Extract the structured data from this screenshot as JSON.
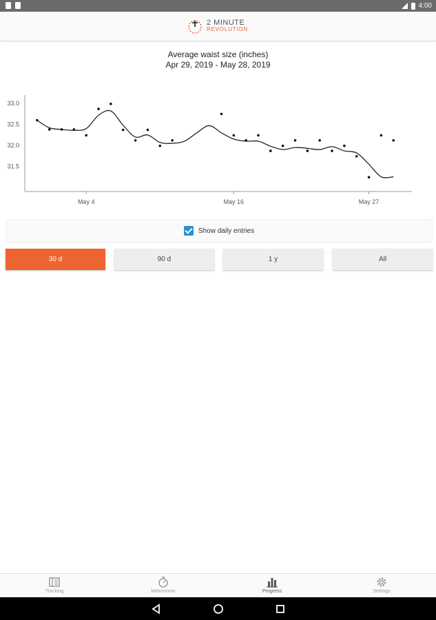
{
  "status_bar": {
    "time": "4:00"
  },
  "app_bar": {
    "logo_line1": "2 MINUTE",
    "logo_line2": "REVOLUTION"
  },
  "chart_title_line1": "Average waist size (inches)",
  "chart_title_line2": "Apr 29, 2019 - May 28, 2019",
  "chart_data": {
    "type": "line",
    "title": "Average waist size (inches)",
    "subtitle": "Apr 29, 2019 - May 28, 2019",
    "x_tick_labels": [
      "May 4",
      "May 16",
      "May 27"
    ],
    "x_tick_days": [
      5,
      17,
      28
    ],
    "y_tick_labels": [
      "33.0",
      "32.5",
      "32.0",
      "31.5"
    ],
    "y_ticks": [
      33.0,
      32.5,
      32.0,
      31.5
    ],
    "ylim": [
      30.9,
      33.2
    ],
    "xlim": [
      0,
      31.5
    ],
    "daily_entries": {
      "day": [
        1,
        2,
        3,
        4,
        5,
        6,
        7,
        8,
        9,
        10,
        11,
        12,
        16,
        17,
        18,
        19,
        20,
        21,
        22,
        23,
        24,
        25,
        26,
        27,
        28,
        29,
        30
      ],
      "waist": [
        32.6,
        32.38,
        32.38,
        32.38,
        32.24,
        32.87,
        32.99,
        32.37,
        32.12,
        32.37,
        31.99,
        32.12,
        32.75,
        32.24,
        32.12,
        32.24,
        31.87,
        31.99,
        32.12,
        31.87,
        32.12,
        31.87,
        31.99,
        31.74,
        31.24,
        32.24,
        32.12
      ]
    },
    "trend": {
      "day": [
        1,
        2,
        3,
        4,
        5,
        6,
        7,
        8,
        9,
        10,
        11,
        12,
        13,
        14,
        15,
        16,
        17,
        18,
        19,
        20,
        21,
        22,
        23,
        24,
        25,
        26,
        27,
        28,
        29,
        30
      ],
      "waist": [
        32.6,
        32.42,
        32.38,
        32.36,
        32.4,
        32.72,
        32.82,
        32.48,
        32.2,
        32.25,
        32.07,
        32.05,
        32.1,
        32.3,
        32.47,
        32.3,
        32.15,
        32.1,
        32.1,
        31.98,
        31.9,
        31.95,
        31.93,
        31.9,
        31.97,
        31.87,
        31.82,
        31.55,
        31.25,
        31.25
      ]
    },
    "grid": false,
    "legend": "none"
  },
  "show_daily_entries": {
    "label": "Show daily entries",
    "checked": true
  },
  "range_buttons": [
    {
      "label": "30 d",
      "active": true
    },
    {
      "label": "90 d",
      "active": false
    },
    {
      "label": "1 y",
      "active": false
    },
    {
      "label": "All",
      "active": false
    }
  ],
  "bottom_nav": [
    {
      "label": "Tracking",
      "icon": "tracking-icon"
    },
    {
      "label": "Metronome",
      "icon": "metronome-icon"
    },
    {
      "label": "Progress",
      "icon": "bar-chart-icon",
      "active": true
    },
    {
      "label": "Settings",
      "icon": "gear-icon"
    }
  ],
  "colors": {
    "accent": "#ee6430",
    "checkbox": "#2b8fd6"
  }
}
